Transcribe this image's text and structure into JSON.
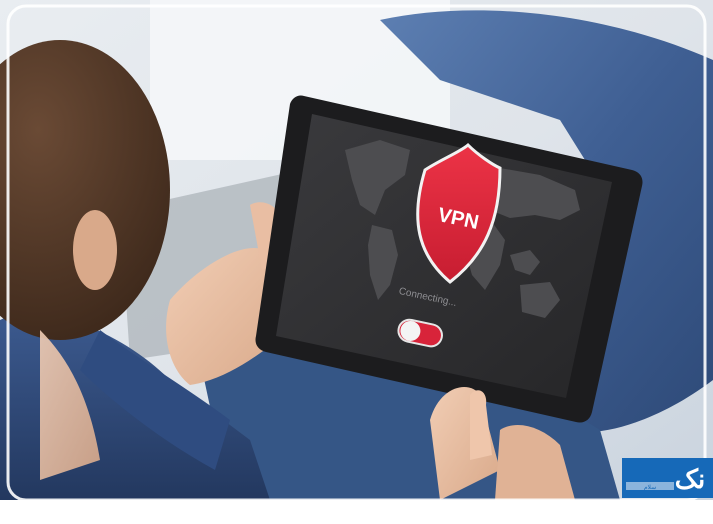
{
  "screen": {
    "shield_label": "VPN",
    "status_text": "Connecting...",
    "toggle_state": "on"
  },
  "watermark": {
    "logo_text": "نک",
    "small_text": "سلام"
  },
  "colors": {
    "shield_red": "#e0283c",
    "screen_bg": "#2e2e30",
    "map_gray": "#4d4d50",
    "toggle_red": "#d8243a",
    "watermark_blue": "#1669b8"
  },
  "icons": {
    "shield": "shield-icon",
    "toggle": "toggle-switch-icon",
    "map": "world-map-icon"
  }
}
